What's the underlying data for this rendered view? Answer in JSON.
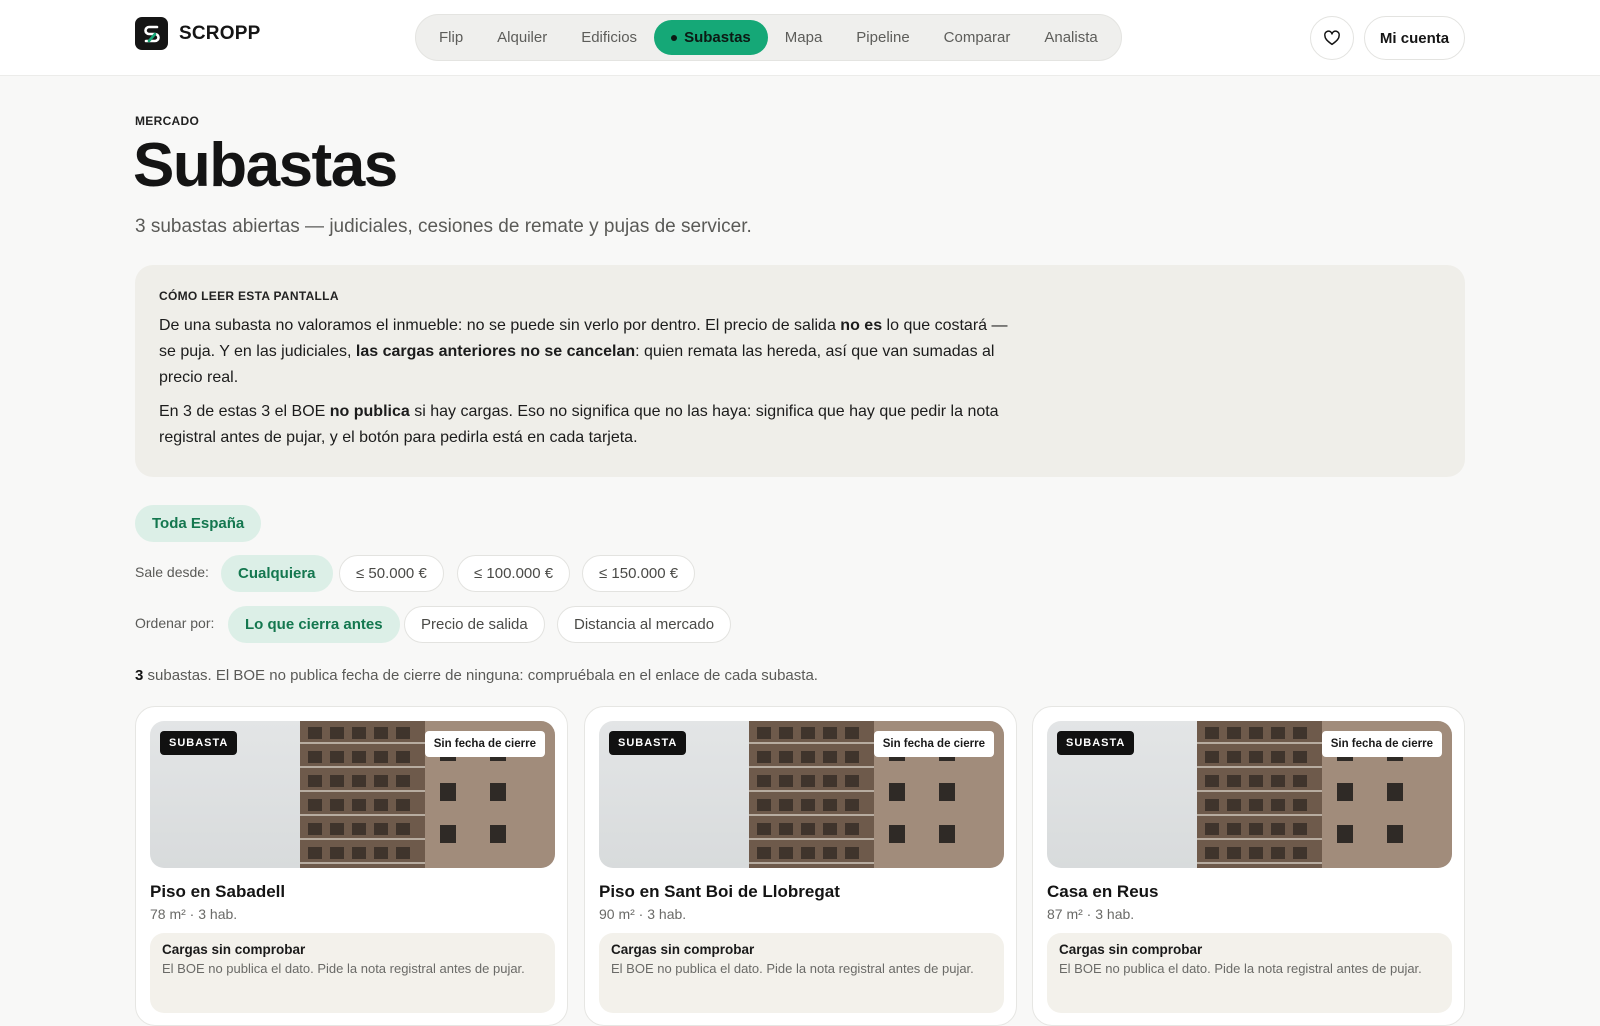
{
  "brand": {
    "name": "SCROPP"
  },
  "nav": {
    "items": [
      {
        "label": "Flip",
        "active": false
      },
      {
        "label": "Alquiler",
        "active": false
      },
      {
        "label": "Edificios",
        "active": false
      },
      {
        "label": "Subastas",
        "active": true
      },
      {
        "label": "Mapa",
        "active": false
      },
      {
        "label": "Pipeline",
        "active": false
      },
      {
        "label": "Comparar",
        "active": false
      },
      {
        "label": "Analista",
        "active": false
      }
    ]
  },
  "header": {
    "account_label": "Mi cuenta",
    "favorites_icon": "heart-icon"
  },
  "page": {
    "eyebrow": "MERCADO",
    "title": "Subastas",
    "subtitle": "3 subastas abiertas — judiciales, cesiones de remate y pujas de servicer."
  },
  "info": {
    "eyebrow": "CÓMO LEER ESTA PANTALLA",
    "p1_a": "De una subasta no valoramos el inmueble: no se puede sin verlo por dentro. El precio de salida ",
    "p1_b": "no es",
    "p1_c": " lo que costará — se puja. Y en las judiciales, ",
    "p1_d": "las cargas anteriores no se cancelan",
    "p1_e": ": quien remata las hereda, así que van sumadas al precio real.",
    "p2_a": "En 3 de estas 3 el BOE ",
    "p2_b": "no publica",
    "p2_c": " si hay cargas. Eso no significa que no las haya: significa que hay que pedir la nota registral antes de pujar, y el botón para pedirla está en cada tarjeta."
  },
  "filters": {
    "region_label": "Toda España",
    "price_label": "Sale desde:",
    "price_options": [
      "Cualquiera",
      "≤ 50.000 €",
      "≤ 100.000 €",
      "≤ 150.000 €"
    ],
    "sort_label": "Ordenar por:",
    "sort_options": [
      "Lo que cierra antes",
      "Precio de salida",
      "Distancia al mercado"
    ]
  },
  "results": {
    "count": "3",
    "text": " subastas. El BOE no publica fecha de cierre de ninguna: compruébala en el enlace de cada subasta."
  },
  "cards": [
    {
      "badge": "SUBASTA",
      "date_badge": "Sin fecha de cierre",
      "title": "Piso en Sabadell",
      "meta": "78 m² · 3 hab.",
      "note_title": "Cargas sin comprobar",
      "note_text": "El BOE no publica el dato. Pide la nota registral antes de pujar."
    },
    {
      "badge": "SUBASTA",
      "date_badge": "Sin fecha de cierre",
      "title": "Piso en Sant Boi de Llobregat",
      "meta": "90 m² · 3 hab.",
      "note_title": "Cargas sin comprobar",
      "note_text": "El BOE no publica el dato. Pide la nota registral antes de pujar."
    },
    {
      "badge": "SUBASTA",
      "date_badge": "Sin fecha de cierre",
      "title": "Casa en Reus",
      "meta": "87 m² · 3 hab.",
      "note_title": "Cargas sin comprobar",
      "note_text": "El BOE no publica el dato. Pide la nota registral antes de pujar."
    }
  ],
  "colors": {
    "accent": "#15a877",
    "accent_soft": "#dcefe7",
    "accent_text": "#14774f"
  }
}
